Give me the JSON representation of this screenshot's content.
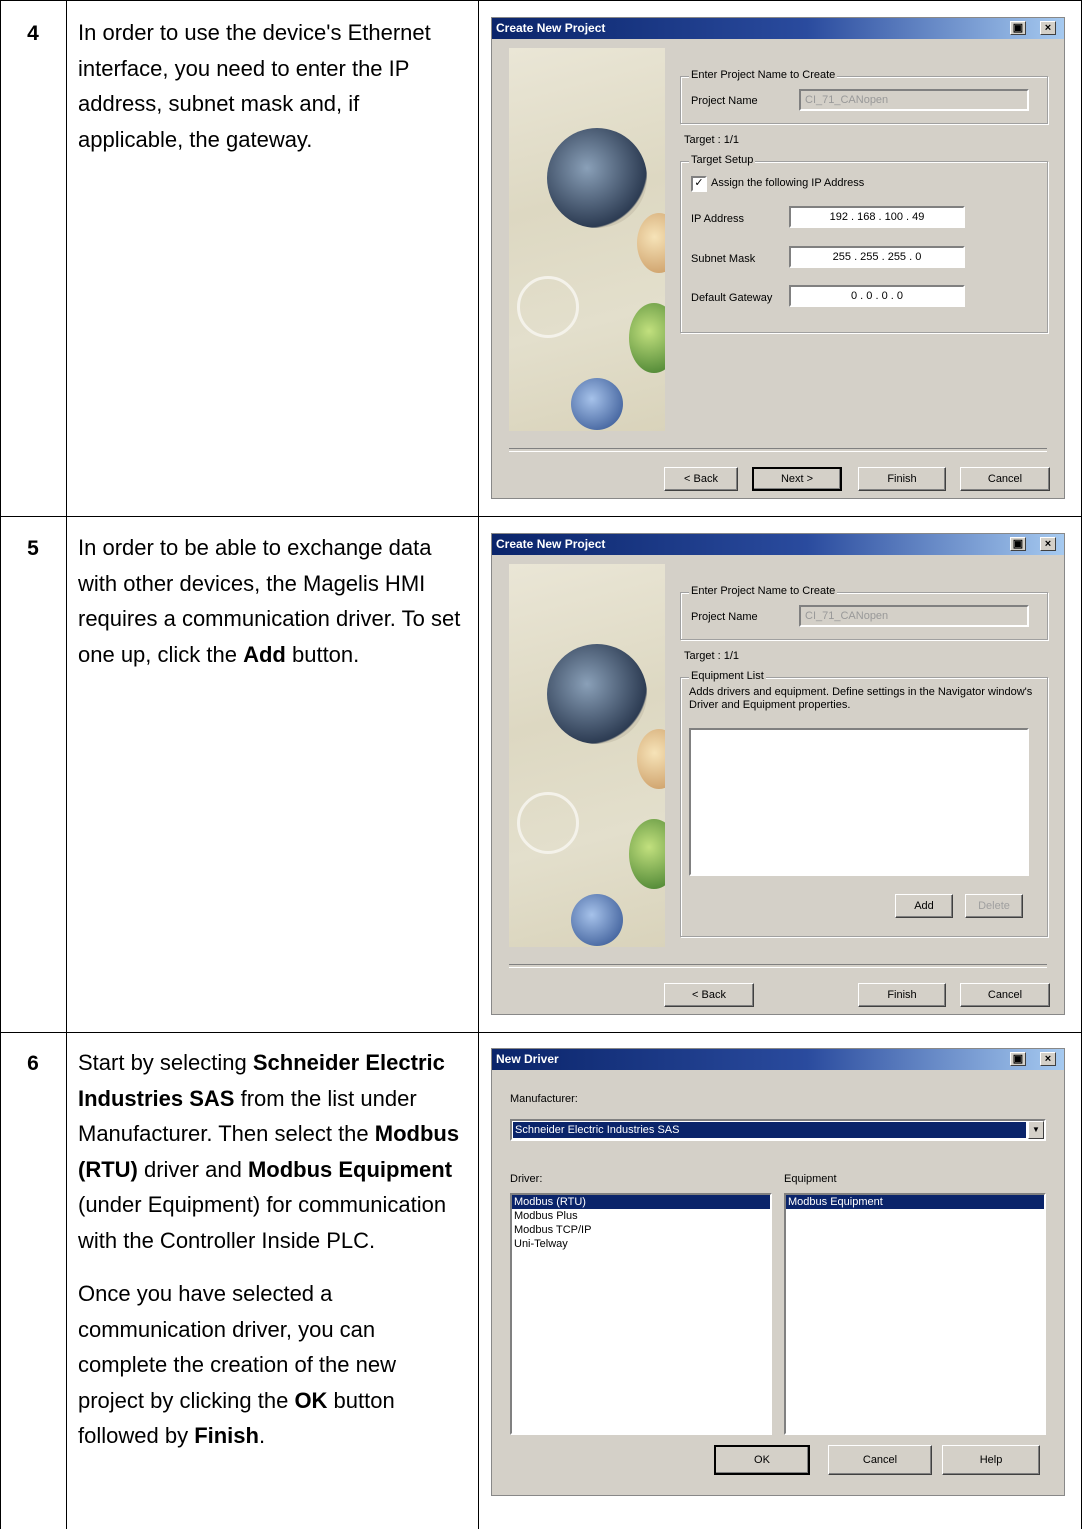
{
  "steps": [
    {
      "number": "4",
      "text": "In order to use the device's Ethernet interface, you need to enter the IP address, subnet mask and, if applicable, the gateway."
    },
    {
      "number": "5",
      "text_a": "In order to be able to exchange data with other devices, the Magelis HMI requires a communication driver. To set one up, click the ",
      "text_bold": "Add",
      "text_b": " button."
    },
    {
      "number": "6",
      "p1_a": "Start by selecting ",
      "p1_b1": "Schneider Electric Industries SAS",
      "p1_c": " from the list under Manufacturer. Then select the ",
      "p1_b2": "Modbus (RTU)",
      "p1_d": " driver and ",
      "p1_b3": "Modbus Equipment",
      "p1_e": " (under Equipment) for communication with the Controller Inside PLC.",
      "p2_a": "Once you have selected a communication driver, you can complete the creation of the new project by clicking the ",
      "p2_b1": "OK",
      "p2_c": " button followed by ",
      "p2_b2": "Finish",
      "p2_d": "."
    }
  ],
  "dialog1": {
    "title": "Create New Project",
    "project_group": "Enter Project Name to Create",
    "project_name_label": "Project Name",
    "project_name_value": "CI_71_CANopen",
    "target": "Target : 1/1",
    "setup_group": "Target Setup",
    "assign_label": "Assign the following IP Address",
    "assign_checked": "✓",
    "ip_label": "IP Address",
    "ip_value": "192 . 168 . 100 . 49",
    "subnet_label": "Subnet Mask",
    "subnet_value": "255 . 255 . 255 . 0",
    "gateway_label": "Default Gateway",
    "gateway_value": "0 . 0 . 0 . 0",
    "back": "< Back",
    "next": "Next >",
    "finish": "Finish",
    "cancel": "Cancel"
  },
  "dialog2": {
    "title": "Create New Project",
    "project_group": "Enter Project Name to Create",
    "project_name_label": "Project Name",
    "project_name_value": "CI_71_CANopen",
    "target": "Target : 1/1",
    "equipment_group": "Equipment List",
    "equipment_desc": "Adds drivers and equipment. Define settings in the Navigator window's Driver and Equipment properties.",
    "add": "Add",
    "delete": "Delete",
    "back": "< Back",
    "finish": "Finish",
    "cancel": "Cancel"
  },
  "dialog3": {
    "title": "New Driver",
    "manufacturer_label": "Manufacturer:",
    "manufacturer_value": "Schneider Electric Industries SAS",
    "driver_label": "Driver:",
    "equipment_label": "Equipment",
    "drivers": [
      "Modbus (RTU)",
      "Modbus Plus",
      "Modbus TCP/IP",
      "Uni-Telway"
    ],
    "equipment": [
      "Modbus Equipment"
    ],
    "ok": "OK",
    "cancel": "Cancel",
    "help": "Help"
  }
}
